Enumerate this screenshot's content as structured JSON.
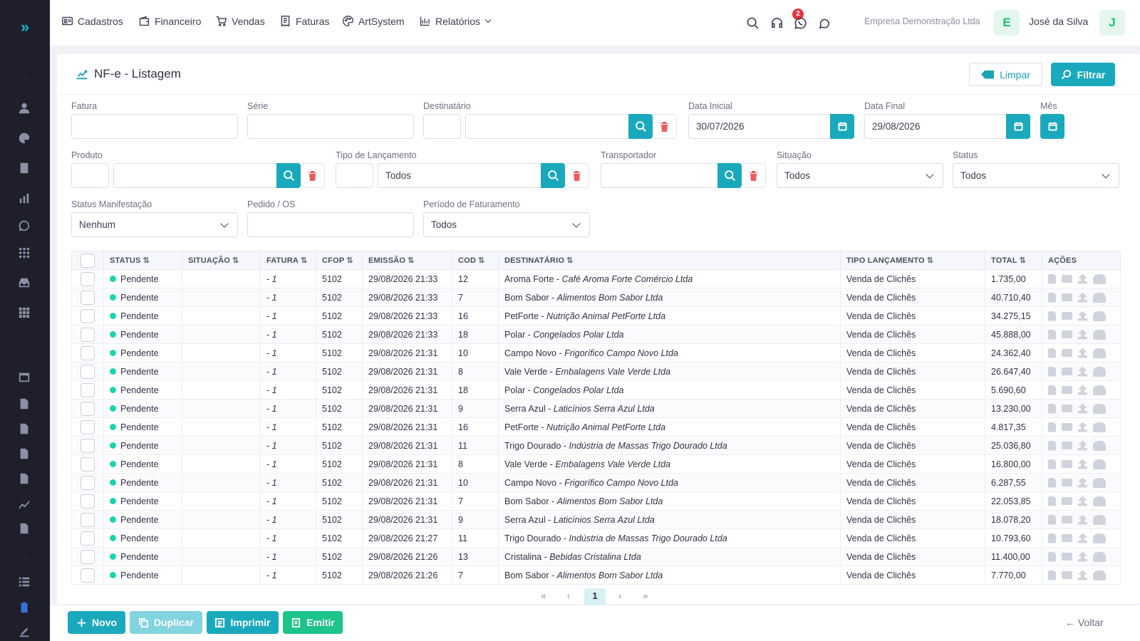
{
  "nav": {
    "items": [
      {
        "label": "Cadastros",
        "icon": "id-card-icon"
      },
      {
        "label": "Financeiro",
        "icon": "wallet-icon"
      },
      {
        "label": "Vendas",
        "icon": "cart-icon"
      },
      {
        "label": "Faturas",
        "icon": "receipt-icon"
      },
      {
        "label": "ArtSystem",
        "icon": "palette-icon"
      },
      {
        "label": "Relatórios",
        "icon": "bar-chart-icon"
      }
    ],
    "support_badge": "2",
    "company": "Empresa Demonstração Ltda",
    "company_initial": "E",
    "user": "José da Silva",
    "user_initial": "J"
  },
  "page": {
    "title": "NF-e - Listagem",
    "limpar_label": "Limpar",
    "filtrar_label": "Filtrar"
  },
  "filters": {
    "fatura_label": "Fatura",
    "serie_label": "Série",
    "destinatario_label": "Destinatário",
    "data_inicial_label": "Data Inicial",
    "data_inicial_value": "30/07/2026",
    "data_final_label": "Data Final",
    "data_final_value": "29/08/2026",
    "mes_label": "Mês",
    "produto_label": "Produto",
    "tipo_lancamento_label": "Tipo de Lançamento",
    "tipo_lancamento_value": "Todos",
    "transportador_label": "Transportador",
    "situacao_label": "Situação",
    "situacao_value": "Todos",
    "status_label": "Status",
    "status_value": "Todos",
    "status_manifestacao_label": "Status Manifestação",
    "status_manifestacao_value": "Nenhum",
    "pedido_label": "Pedido / OS",
    "periodo_label": "Período de Faturamento",
    "periodo_value": "Todos"
  },
  "table": {
    "headers": {
      "status": "STATUS",
      "situacao": "SITUAÇÃO",
      "fatura": "FATURA",
      "cfop": "CFOP",
      "emissao": "EMISSÃO",
      "cod": "COD",
      "destinatario": "DESTINATÁRIO",
      "tipo": "TIPO LANÇAMENTO",
      "total": "TOTAL",
      "acoes": "AÇÕES"
    },
    "sort_glyph": "⇅",
    "rows": [
      {
        "status": "Pendente",
        "situacao": "",
        "fatura": "- 1",
        "cfop": "5102",
        "emissao": "29/08/2026 21:33",
        "cod": "12",
        "dest": "Aroma Forte",
        "dest_sub": "Café Aroma Forte Comércio Ltda",
        "tipo": "Venda de Clichês",
        "total": "1.735,00"
      },
      {
        "status": "Pendente",
        "situacao": "",
        "fatura": "- 1",
        "cfop": "5102",
        "emissao": "29/08/2026 21:33",
        "cod": "7",
        "dest": "Bom Sabor",
        "dest_sub": "Alimentos Bom Sabor Ltda",
        "tipo": "Venda de Clichês",
        "total": "40.710,40"
      },
      {
        "status": "Pendente",
        "situacao": "",
        "fatura": "- 1",
        "cfop": "5102",
        "emissao": "29/08/2026 21:33",
        "cod": "16",
        "dest": "PetForte",
        "dest_sub": "Nutrição Animal PetForte Ltda",
        "tipo": "Venda de Clichês",
        "total": "34.275,15"
      },
      {
        "status": "Pendente",
        "situacao": "",
        "fatura": "- 1",
        "cfop": "5102",
        "emissao": "29/08/2026 21:33",
        "cod": "18",
        "dest": "Polar",
        "dest_sub": "Congelados Polar Ltda",
        "tipo": "Venda de Clichês",
        "total": "45.888,00"
      },
      {
        "status": "Pendente",
        "situacao": "",
        "fatura": "- 1",
        "cfop": "5102",
        "emissao": "29/08/2026 21:31",
        "cod": "10",
        "dest": "Campo Novo",
        "dest_sub": "Frigorífico Campo Novo Ltda",
        "tipo": "Venda de Clichês",
        "total": "24.362,40"
      },
      {
        "status": "Pendente",
        "situacao": "",
        "fatura": "- 1",
        "cfop": "5102",
        "emissao": "29/08/2026 21:31",
        "cod": "8",
        "dest": "Vale Verde",
        "dest_sub": "Embalagens Vale Verde Ltda",
        "tipo": "Venda de Clichês",
        "total": "26.647,40"
      },
      {
        "status": "Pendente",
        "situacao": "",
        "fatura": "- 1",
        "cfop": "5102",
        "emissao": "29/08/2026 21:31",
        "cod": "18",
        "dest": "Polar",
        "dest_sub": "Congelados Polar Ltda",
        "tipo": "Venda de Clichês",
        "total": "5.690,60"
      },
      {
        "status": "Pendente",
        "situacao": "",
        "fatura": "- 1",
        "cfop": "5102",
        "emissao": "29/08/2026 21:31",
        "cod": "9",
        "dest": "Serra Azul",
        "dest_sub": "Laticínios Serra Azul Ltda",
        "tipo": "Venda de Clichês",
        "total": "13.230,00"
      },
      {
        "status": "Pendente",
        "situacao": "",
        "fatura": "- 1",
        "cfop": "5102",
        "emissao": "29/08/2026 21:31",
        "cod": "16",
        "dest": "PetForte",
        "dest_sub": "Nutrição Animal PetForte Ltda",
        "tipo": "Venda de Clichês",
        "total": "4.817,35"
      },
      {
        "status": "Pendente",
        "situacao": "",
        "fatura": "- 1",
        "cfop": "5102",
        "emissao": "29/08/2026 21:31",
        "cod": "11",
        "dest": "Trigo Dourado",
        "dest_sub": "Indústria de Massas Trigo Dourado Ltda",
        "tipo": "Venda de Clichês",
        "total": "25.036,80"
      },
      {
        "status": "Pendente",
        "situacao": "",
        "fatura": "- 1",
        "cfop": "5102",
        "emissao": "29/08/2026 21:31",
        "cod": "8",
        "dest": "Vale Verde",
        "dest_sub": "Embalagens Vale Verde Ltda",
        "tipo": "Venda de Clichês",
        "total": "16.800,00"
      },
      {
        "status": "Pendente",
        "situacao": "",
        "fatura": "- 1",
        "cfop": "5102",
        "emissao": "29/08/2026 21:31",
        "cod": "10",
        "dest": "Campo Novo",
        "dest_sub": "Frigorífico Campo Novo Ltda",
        "tipo": "Venda de Clichês",
        "total": "6.287,55"
      },
      {
        "status": "Pendente",
        "situacao": "",
        "fatura": "- 1",
        "cfop": "5102",
        "emissao": "29/08/2026 21:31",
        "cod": "7",
        "dest": "Bom Sabor",
        "dest_sub": "Alimentos Bom Sabor Ltda",
        "tipo": "Venda de Clichês",
        "total": "22.053,85"
      },
      {
        "status": "Pendente",
        "situacao": "",
        "fatura": "- 1",
        "cfop": "5102",
        "emissao": "29/08/2026 21:31",
        "cod": "9",
        "dest": "Serra Azul",
        "dest_sub": "Laticínios Serra Azul Ltda",
        "tipo": "Venda de Clichês",
        "total": "18.078,20"
      },
      {
        "status": "Pendente",
        "situacao": "",
        "fatura": "- 1",
        "cfop": "5102",
        "emissao": "29/08/2026 21:27",
        "cod": "11",
        "dest": "Trigo Dourado",
        "dest_sub": "Indústria de Massas Trigo Dourado Ltda",
        "tipo": "Venda de Clichês",
        "total": "10.793,60"
      },
      {
        "status": "Pendente",
        "situacao": "",
        "fatura": "- 1",
        "cfop": "5102",
        "emissao": "29/08/2026 21:26",
        "cod": "13",
        "dest": "Cristalina",
        "dest_sub": "Bebidas Cristalina Ltda",
        "tipo": "Venda de Clichês",
        "total": "11.400,00"
      },
      {
        "status": "Pendente",
        "situacao": "",
        "fatura": "- 1",
        "cfop": "5102",
        "emissao": "29/08/2026 21:26",
        "cod": "7",
        "dest": "Bom Sabor",
        "dest_sub": "Alimentos Bom Sabor Ltda",
        "tipo": "Venda de Clichês",
        "total": "7.770,00"
      }
    ]
  },
  "pagination": {
    "first": "«",
    "prev": "‹",
    "current": "1",
    "next": "›",
    "last": "»"
  },
  "bottom": {
    "novo_label": "Novo",
    "duplicar_label": "Duplicar",
    "imprimir_label": "Imprimir",
    "emitir_label": "Emitir",
    "voltar_label": "← Voltar"
  },
  "colors": {
    "accent": "#1aa9bc",
    "sidebar": "#1e1f2b",
    "success": "#1cc38a",
    "status_dot": "#1dd3b0",
    "danger": "#ec5b5b"
  }
}
